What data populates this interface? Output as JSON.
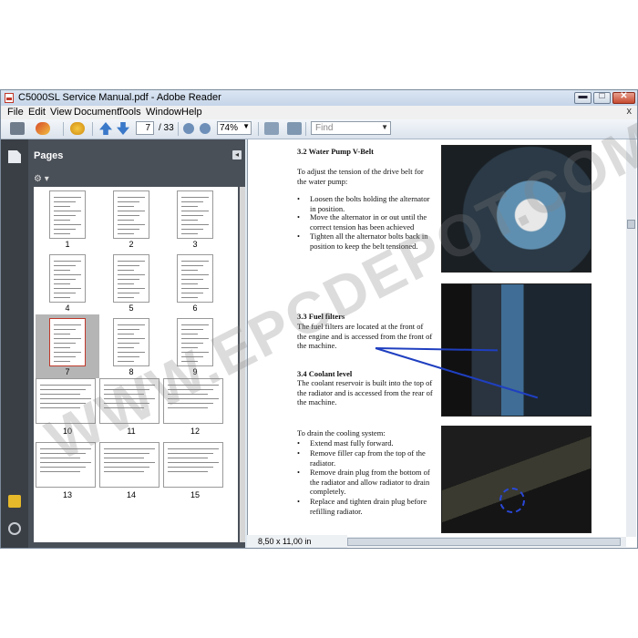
{
  "window": {
    "title": "C5000SL Service Manual.pdf - Adobe Reader",
    "min_label": "▬",
    "max_label": "□",
    "close_label": "✕"
  },
  "menu": {
    "items": [
      "File",
      "Edit",
      "View",
      "Document",
      "Tools",
      "Window",
      "Help"
    ],
    "close_doc": "x"
  },
  "toolbar": {
    "current_page": "7",
    "total_pages": "/ 33",
    "zoom": "74%",
    "find_placeholder": "Find"
  },
  "pages_panel": {
    "title": "Pages",
    "thumbnails": [
      "1",
      "2",
      "3",
      "4",
      "5",
      "6",
      "7",
      "8",
      "9",
      "10",
      "11",
      "12",
      "13",
      "14",
      "15"
    ],
    "selected": "7"
  },
  "document": {
    "water_pump": {
      "heading": "3.2 Water Pump V-Belt",
      "intro": "To adjust the tension of the drive belt for the water pump:",
      "bullets": [
        "Loosen the bolts holding the alternator in position.",
        "Move the alternator in or out until the correct tension has been achieved",
        "Tighten all the alternator bolts back in position to keep the belt tensioned."
      ]
    },
    "fuel": {
      "heading": "3.3 Fuel filters",
      "text": "The fuel filters are located at the front of the engine and is accessed from the front of the machine."
    },
    "coolant": {
      "heading": "3.4 Coolant level",
      "text": "The coolant reservoir is built into the top of the radiator and is accessed from the rear of the machine."
    },
    "drain": {
      "intro": "To drain the cooling system:",
      "bullets": [
        "Extend mast fully forward.",
        "Remove filler cap from the top of the radiator.",
        "Remove drain plug from the bottom of the radiator and allow radiator to drain completely.",
        "Replace and tighten drain plug before refilling radiator."
      ]
    },
    "page_size": "8,50 x 11,00 in"
  },
  "watermark": "WWW.EPCDEPOT.COM",
  "colors": {
    "panel_bg": "#4a5058",
    "rail_bg": "#3a3f45",
    "arrow_blue": "#1f3fc0"
  }
}
